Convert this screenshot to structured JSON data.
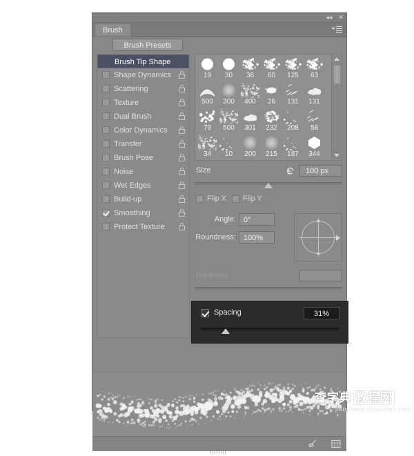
{
  "window": {
    "collapse_icon": "«",
    "close_icon": "×"
  },
  "tabs": [
    {
      "label": "Brush"
    }
  ],
  "toolbar": {
    "brush_presets_label": "Brush Presets",
    "panel_menu_icon": "panel-menu-icon"
  },
  "sidebar": {
    "items": [
      {
        "label": "Brush Tip Shape",
        "checked": false,
        "selected": true,
        "lock": false
      },
      {
        "label": "Shape Dynamics",
        "checked": false,
        "selected": false,
        "lock": true
      },
      {
        "label": "Scattering",
        "checked": false,
        "selected": false,
        "lock": true
      },
      {
        "label": "Texture",
        "checked": false,
        "selected": false,
        "lock": true
      },
      {
        "label": "Dual Brush",
        "checked": false,
        "selected": false,
        "lock": true
      },
      {
        "label": "Color Dynamics",
        "checked": false,
        "selected": false,
        "lock": true
      },
      {
        "label": "Transfer",
        "checked": false,
        "selected": false,
        "lock": true
      },
      {
        "label": "Brush Pose",
        "checked": false,
        "selected": false,
        "lock": true
      },
      {
        "label": "Noise",
        "checked": false,
        "selected": false,
        "lock": true
      },
      {
        "label": "Wet Edges",
        "checked": false,
        "selected": false,
        "lock": true
      },
      {
        "label": "Build-up",
        "checked": false,
        "selected": false,
        "lock": true
      },
      {
        "label": "Smoothing",
        "checked": true,
        "selected": false,
        "lock": true
      },
      {
        "label": "Protect Texture",
        "checked": false,
        "selected": false,
        "lock": true
      }
    ]
  },
  "brush_grid": {
    "rows": [
      [
        {
          "size": "19",
          "kind": "soft-round"
        },
        {
          "size": "30",
          "kind": "soft-round"
        },
        {
          "size": "36",
          "kind": "speckle"
        },
        {
          "size": "60",
          "kind": "speckle"
        },
        {
          "size": "125",
          "kind": "speckle"
        },
        {
          "size": "63",
          "kind": "speckle"
        }
      ],
      [
        {
          "size": "500",
          "kind": "arc"
        },
        {
          "size": "300",
          "kind": "glow"
        },
        {
          "size": "400",
          "kind": "grain"
        },
        {
          "size": "26",
          "kind": "blob"
        },
        {
          "size": "131",
          "kind": "streak"
        },
        {
          "size": "131",
          "kind": "cloud"
        }
      ],
      [
        {
          "size": "79",
          "kind": "dots"
        },
        {
          "size": "500",
          "kind": "grain"
        },
        {
          "size": "301",
          "kind": "cloud"
        },
        {
          "size": "232",
          "kind": "splat"
        },
        {
          "size": "208",
          "kind": "sparse"
        },
        {
          "size": "58",
          "kind": "streak"
        }
      ],
      [
        {
          "size": "34",
          "kind": "grain"
        },
        {
          "size": "10",
          "kind": "sparse"
        },
        {
          "size": "200",
          "kind": "glow"
        },
        {
          "size": "215",
          "kind": "glow"
        },
        {
          "size": "187",
          "kind": "sparse"
        },
        {
          "size": "344",
          "kind": "hex"
        }
      ],
      [
        {
          "size": "",
          "kind": "splat"
        },
        {
          "size": "",
          "kind": "blob"
        },
        {
          "size": "",
          "kind": "grain"
        },
        {
          "size": "",
          "kind": "sparse"
        },
        {
          "size": "",
          "kind": "splat"
        },
        {
          "size": "",
          "kind": "grain"
        }
      ]
    ],
    "scrollbar": {
      "up_arrow_icon": "scroll-up-icon",
      "down_arrow_icon": "scroll-down-icon"
    }
  },
  "controls": {
    "size": {
      "label": "Size",
      "value": "100 px",
      "slider_percent": 50,
      "reset_icon": "reset-icon"
    },
    "flip_x": {
      "label": "Flip X",
      "checked": false
    },
    "flip_y": {
      "label": "Flip Y",
      "checked": false
    },
    "angle": {
      "label": "Angle:",
      "value": "0°"
    },
    "roundness": {
      "label": "Roundness:",
      "value": "100%"
    },
    "hardness": {
      "label": "Hardness",
      "value": "",
      "slider_percent": 0,
      "disabled": true
    },
    "spacing": {
      "label": "Spacing",
      "value": "31%",
      "checked": true,
      "slider_percent": 18
    },
    "angle_widget_name": "angle-roundness-dial"
  },
  "preview": {
    "name": "brush-stroke-preview"
  },
  "bottombar": {
    "new_brush_icon": "new-brush-icon",
    "toggle_icon": "toggle-brush-panel-icon",
    "grip_icon": "resize-grip"
  },
  "watermark": {
    "text_main": "查字典",
    "text_box": "教程网",
    "text_sub": "jiaocheng.chazidian.com"
  },
  "colors": {
    "panel_bg": "#888888",
    "selected_item": "#4a4f63",
    "spacing_highlight": "#2b2b2b",
    "text": "#e2e2e2"
  }
}
